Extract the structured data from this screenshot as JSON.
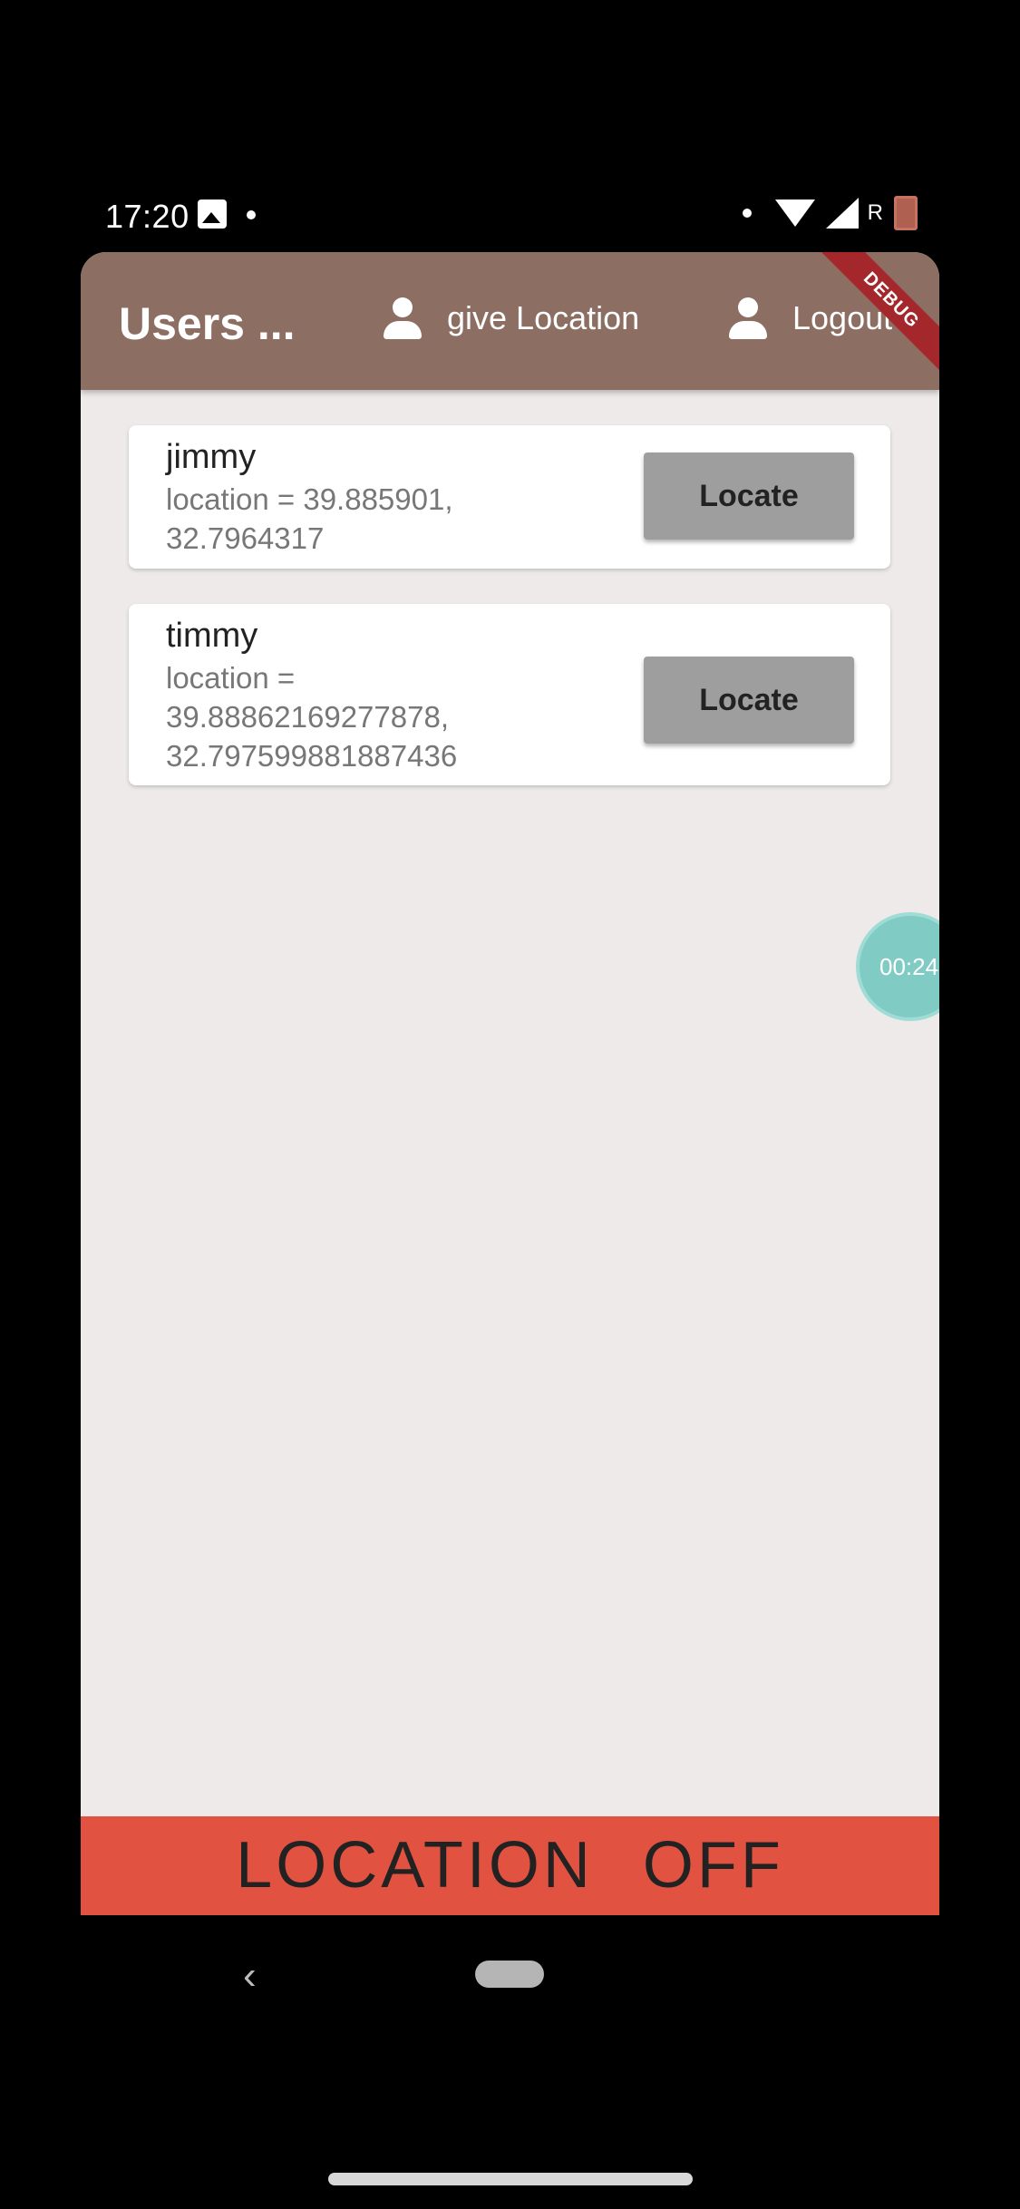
{
  "status_bar": {
    "time": "17:20",
    "network_label": "R"
  },
  "appbar": {
    "title": "Users ...",
    "give_location_label": "give Location",
    "logout_label": "Logout",
    "debug_label": "DEBUG",
    "color": "#8D6E63"
  },
  "users": [
    {
      "name": "jimmy",
      "location_text": "location = 39.885901, 32.7964317",
      "button_label": "Locate"
    },
    {
      "name": "timmy",
      "location_text": "location = 39.88862169277878, 32.797599881887436",
      "button_label": "Locate"
    }
  ],
  "timer": {
    "text": "00:24"
  },
  "location_status": {
    "text": "LOCATION   OFF",
    "color": "#E15241"
  }
}
